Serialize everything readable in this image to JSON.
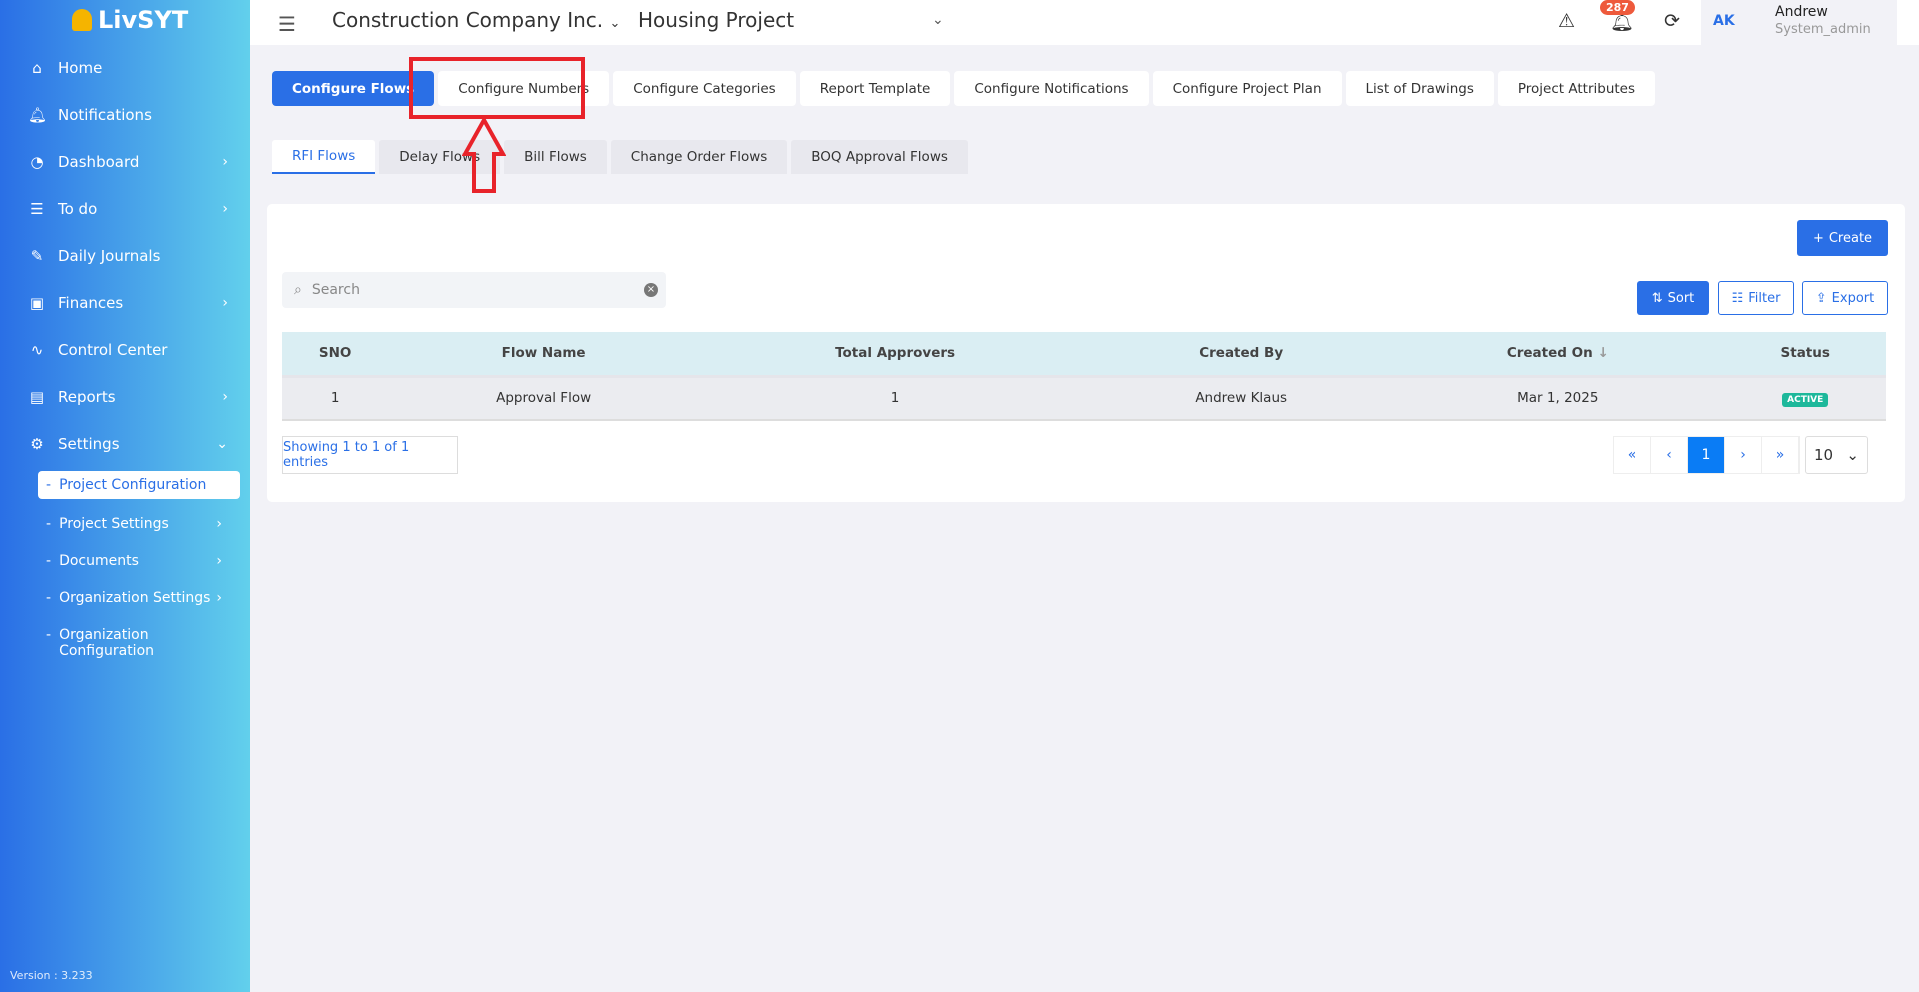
{
  "sidebar": {
    "logo": "LivSYT",
    "items": [
      {
        "label": "Home",
        "icon": "home-icon"
      },
      {
        "label": "Notifications",
        "icon": "bell-icon"
      },
      {
        "label": "Dashboard",
        "icon": "gauge-icon"
      },
      {
        "label": "To do",
        "icon": "list-icon"
      },
      {
        "label": "Daily Journals",
        "icon": "pencil-icon"
      },
      {
        "label": "Finances",
        "icon": "money-icon"
      },
      {
        "label": "Control Center",
        "icon": "pulse-icon"
      },
      {
        "label": "Reports",
        "icon": "report-icon"
      },
      {
        "label": "Settings",
        "icon": "gear-icon"
      }
    ],
    "sub_items": [
      {
        "label": "Project Configuration"
      },
      {
        "label": "Project Settings"
      },
      {
        "label": "Documents"
      },
      {
        "label": "Organization Settings"
      },
      {
        "label": "Organization Configuration"
      }
    ],
    "version": "Version : 3.233"
  },
  "header": {
    "company": "Construction Company Inc.",
    "project": "Housing Project",
    "notification_count": "287",
    "user": {
      "initials": "AK",
      "name": "Andrew",
      "role": "System_admin"
    }
  },
  "tabs": [
    "Configure Flows",
    "Configure Numbers",
    "Configure Categories",
    "Report Template",
    "Configure Notifications",
    "Configure Project Plan",
    "List of Drawings",
    "Project Attributes"
  ],
  "subtabs": [
    "RFI Flows",
    "Delay Flows",
    "Bill Flows",
    "Change Order Flows",
    "BOQ Approval Flows"
  ],
  "toolbar": {
    "create": "Create",
    "sort": "Sort",
    "filter": "Filter",
    "export": "Export",
    "search_placeholder": "Search"
  },
  "table": {
    "headers": [
      "SNO",
      "Flow Name",
      "Total Approvers",
      "Created By",
      "Created On",
      "Status"
    ],
    "rows": [
      {
        "sno": "1",
        "flow_name": "Approval Flow",
        "total_approvers": "1",
        "created_by": "Andrew Klaus",
        "created_on": "Mar 1, 2025",
        "status": "ACTIVE"
      }
    ]
  },
  "pagination": {
    "showing": "Showing 1 to 1 of 1 entries",
    "current_page": "1",
    "page_size": "10"
  },
  "colors": {
    "primary": "#2a6fe6",
    "annotation": "#e8232a",
    "active_status": "#1db89b"
  }
}
